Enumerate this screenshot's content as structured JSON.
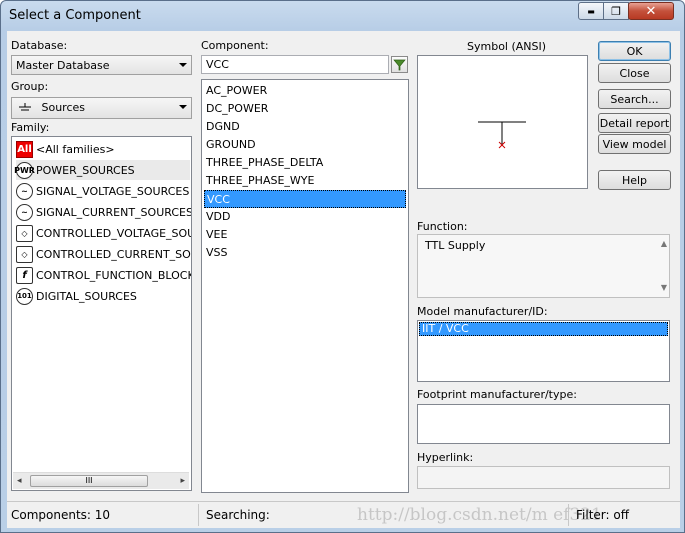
{
  "window": {
    "title": "Select a Component",
    "min_glyph": "▬",
    "max_glyph": "❐",
    "close_glyph": "✕"
  },
  "database": {
    "label": "Database:",
    "value": "Master Database"
  },
  "group": {
    "label": "Group:",
    "value": "Sources",
    "icon": "ground-icon"
  },
  "family": {
    "label": "Family:",
    "items": [
      {
        "label": "<All families>",
        "icon": "all-icon",
        "icon_text": "All"
      },
      {
        "label": "POWER_SOURCES",
        "icon": "power-sources-icon",
        "icon_text": "PWR"
      },
      {
        "label": "SIGNAL_VOLTAGE_SOURCES",
        "icon": "signal-voltage-icon",
        "icon_text": "~"
      },
      {
        "label": "SIGNAL_CURRENT_SOURCES",
        "icon": "signal-current-icon",
        "icon_text": "~"
      },
      {
        "label": "CONTROLLED_VOLTAGE_SOUR",
        "icon": "controlled-voltage-icon",
        "icon_text": "◇"
      },
      {
        "label": "CONTROLLED_CURRENT_SOUI",
        "icon": "controlled-current-icon",
        "icon_text": "◇"
      },
      {
        "label": "CONTROL_FUNCTION_BLOCKS",
        "icon": "function-block-icon",
        "icon_text": "f"
      },
      {
        "label": "DIGITAL_SOURCES",
        "icon": "digital-sources-icon",
        "icon_text": "101"
      }
    ],
    "scroll_grip": "III"
  },
  "component": {
    "label": "Component:",
    "search_value": "VCC",
    "items": [
      "AC_POWER",
      "DC_POWER",
      "DGND",
      "GROUND",
      "THREE_PHASE_DELTA",
      "THREE_PHASE_WYE",
      "VCC",
      "VDD",
      "VEE",
      "VSS"
    ],
    "selected_index": 6
  },
  "symbol": {
    "label": "Symbol (ANSI)"
  },
  "buttons": {
    "ok": "OK",
    "close": "Close",
    "search": "Search...",
    "detail": "Detail report",
    "view_model": "View model",
    "help": "Help"
  },
  "function": {
    "label": "Function:",
    "value": "TTL Supply"
  },
  "model": {
    "label": "Model manufacturer/ID:",
    "items": [
      "IIT / VCC"
    ]
  },
  "footprint": {
    "label": "Footprint manufacturer/type:"
  },
  "hyperlink": {
    "label": "Hyperlink:"
  },
  "status": {
    "components": "Components: 10",
    "searching": "Searching:",
    "filter": "Filter: off",
    "watermark": "http://blog.csdn.net/m   ef321"
  },
  "colors": {
    "selection": "#3399ff",
    "ground_stroke": "#000000",
    "pin_marker": "#cc0000",
    "all_icon": "#e00000"
  }
}
